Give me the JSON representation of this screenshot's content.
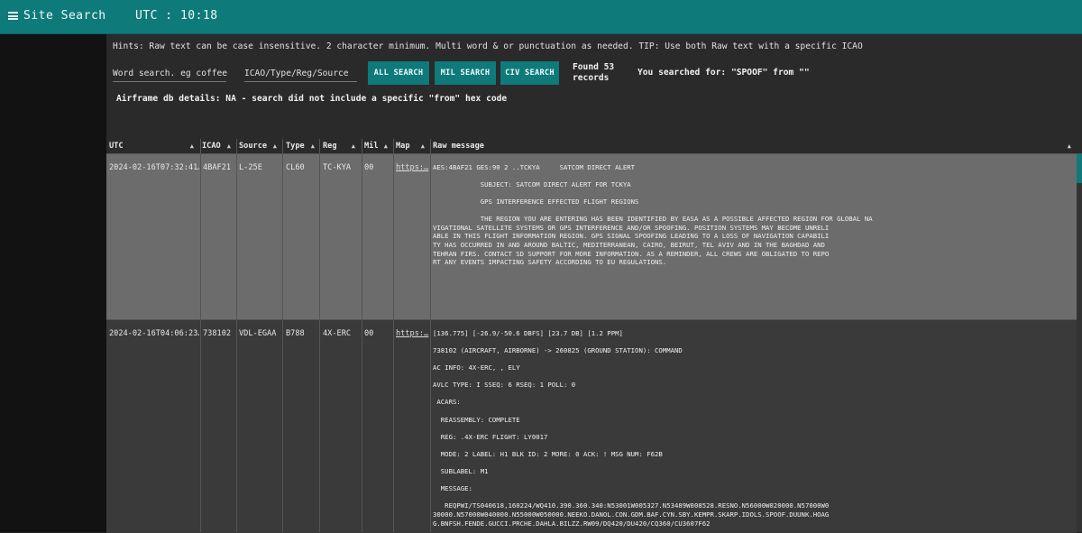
{
  "topbar": {
    "menu_icon": "hamburger-icon",
    "title": "Site Search",
    "utc": "UTC : 10:18"
  },
  "search": {
    "hints": "Hints: Raw text can be case insensitive. 2 character minimum. Multi word & or punctuation as needed. TIP: Use both Raw text with a specific ICAO",
    "word_placeholder": "Word search. eg coffee",
    "icao_placeholder": "ICAO/Type/Reg/Source",
    "buttons": {
      "all": "ALL SEARCH",
      "mil": "MIL SEARCH",
      "civ": "CIV SEARCH"
    },
    "found_line1": "Found 53",
    "found_line2": "records",
    "searched_for": "You searched for: \"SPOOF\" from \"\"",
    "airframe": "Airframe db details: NA - search did not include a specific \"from\" hex code"
  },
  "table": {
    "columns": [
      "UTC",
      "ICAO",
      "Source",
      "Type",
      "Reg",
      "Mil",
      "Map",
      "Raw message"
    ],
    "rows": [
      {
        "utc": "2024-02-16T07:32:41…",
        "icao": "4BAF21",
        "source": "L-25E",
        "type": "CL60",
        "reg": "TC-KYA",
        "mil": "00",
        "map": "https:…",
        "raw": "\nAES:4BAF21 GES:90 2 ..TCKYA     SATCOM DIRECT ALERT\n\n            SUBJECT: SATCOM DIRECT ALERT FOR TCKYA\n\n            GPS INTERFERENCE EFFECTED FLIGHT REGIONS\n\n            THE REGION YOU ARE ENTERING HAS BEEN IDENTIFIED BY EASA AS A POSSIBLE AFFECTED REGION FOR GLOBAL NA\nVIGATIONAL SATELLITE SYSTEMS OR GPS INTERFERENCE AND/OR SPOOFING. POSITION SYSTEMS MAY BECOME UNRELI\nABLE IN THIS FLIGHT INFORMATION REGION. GPS SIGNAL SPOOFING LEADING TO A LOSS OF NAVIGATION CAPABILI\nTY HAS OCCURRED IN AND AROUND BALTIC, MEDITERRANEAN, CAIRO, BEIRUT, TEL AVIV AND IN THE BAGHDAD AND\nTEHRAN FIRS. CONTACT SD SUPPORT FOR MORE INFORMATION. AS A REMINDER, ALL CREWS ARE OBLIGATED TO REPO\nRT ANY EVENTS IMPACTING SAFETY ACCORDING TO EU REGULATIONS."
      },
      {
        "utc": "2024-02-16T04:06:23…",
        "icao": "738102",
        "source": "VDL-EGAA",
        "type": "B788",
        "reg": "4X-ERC",
        "mil": "00",
        "map": "https:…",
        "raw": "\n[136.775] [-26.9/-50.6 DBFS] [23.7 DB] [1.2 PPM]\n\n738102 (AIRCRAFT, AIRBORNE) -> 260825 (GROUND STATION): COMMAND\n\nAC INFO: 4X-ERC, , ELY\n\nAVLC TYPE: I SSEQ: 6 RSEQ: 1 POLL: 0\n\n ACARS:\n\n  REASSEMBLY: COMPLETE\n\n  REG: .4X-ERC FLIGHT: LY0017\n\n  MODE: 2 LABEL: H1 BLK ID: 2 MORE: 0 ACK: ! MSG NUM: F62B\n\n  SUBLABEL: M1\n\n  MESSAGE:\n\n   REQPWI/TS040618,160224/WQ410.390.360.340:N53001W005327.N53489W008528.RESNO.N56000W020000.N57000W0\n30000.N57000W040000.N55000W050000.NEEKO.DANOL.CON.GDM.BAF.CYN.SBY.KEMPR.SKARP.IDOLS.SPOOF.DUUNK.HOAG\nG.BNFSH.FENDE.GUCCI.PRCHE.DAHLA.BILZZ.RW09/DQ420/DU420/CQ360/CU3607F62"
      }
    ]
  }
}
